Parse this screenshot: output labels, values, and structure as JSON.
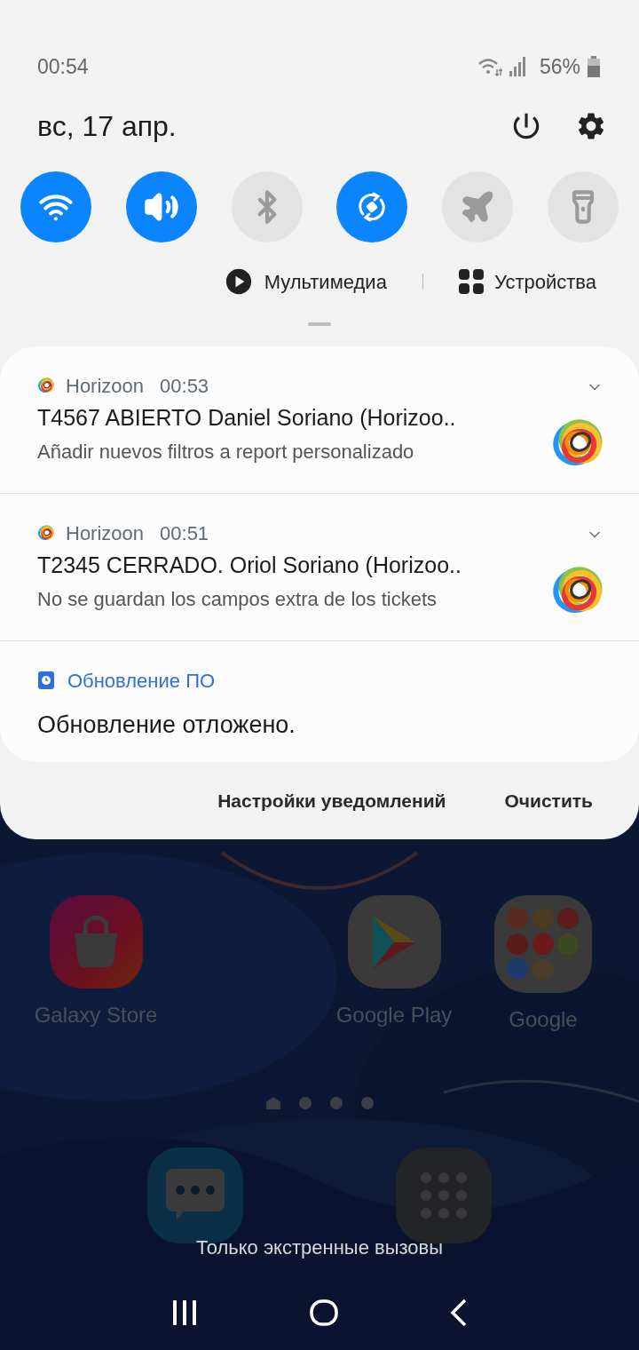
{
  "status_bar": {
    "time": "00:54",
    "battery": "56%"
  },
  "header": {
    "date": "вс, 17 апр."
  },
  "quick_toggles": [
    {
      "kind": "wifi",
      "on": true
    },
    {
      "kind": "sound",
      "on": true
    },
    {
      "kind": "bluetooth",
      "on": false
    },
    {
      "kind": "rotate",
      "on": true
    },
    {
      "kind": "airplane",
      "on": false
    },
    {
      "kind": "flashlight",
      "on": false
    }
  ],
  "media_links": [
    {
      "kind": "media",
      "label": "Мультимедиа"
    },
    {
      "kind": "devices",
      "label": "Устройства"
    }
  ],
  "notifications": [
    {
      "kind": "horizoon",
      "app": "Horizoon",
      "time": "00:53",
      "title": "T4567 ABIERTO Daniel Soriano (Horizoo..",
      "text": "Añadir nuevos filtros a report personalizado"
    },
    {
      "kind": "horizoon",
      "app": "Horizoon",
      "time": "00:51",
      "title": "T2345 CERRADO. Oriol Soriano (Horizoo..",
      "text": "No se guardan los campos extra de los tickets"
    },
    {
      "kind": "system",
      "app": "Обновление ПО",
      "text": "Обновление отложено."
    }
  ],
  "actions": [
    "Настройки уведомлений",
    "Очистить"
  ],
  "home_apps": [
    {
      "kind": "store",
      "label": "Galaxy Store"
    },
    {
      "kind": "play",
      "label": "Google Play"
    },
    {
      "kind": "folder",
      "label": "Google"
    }
  ],
  "dock": [
    {
      "kind": "messages"
    },
    {
      "kind": "apps"
    }
  ],
  "emergency_text": "Только экстренные вызовы"
}
